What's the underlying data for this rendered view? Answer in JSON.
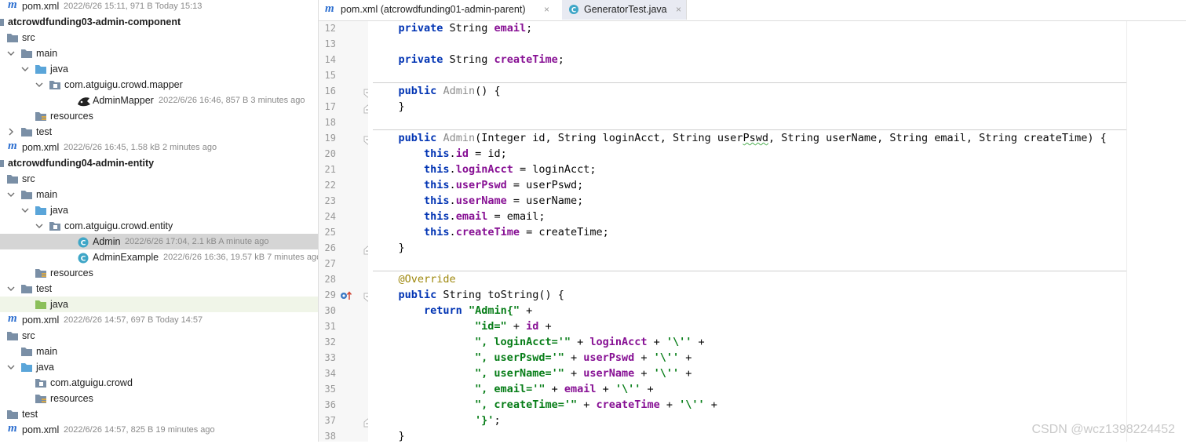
{
  "project_tree": [
    {
      "type": "pom",
      "name": "pom.xml",
      "meta": "2022/6/26 15:11, 971 B Today 15:13",
      "indent": 0
    },
    {
      "type": "module",
      "name": "atcrowdfunding03-admin-component",
      "indent": 0
    },
    {
      "type": "folder",
      "name": "src",
      "indent": 0
    },
    {
      "type": "folder",
      "name": "main",
      "indent": 1,
      "chevron": "down"
    },
    {
      "type": "src-folder",
      "name": "java",
      "indent": 2,
      "chevron": "down"
    },
    {
      "type": "package",
      "name": "com.atguigu.crowd.mapper",
      "indent": 3,
      "chevron": "down"
    },
    {
      "type": "mybatis",
      "name": "AdminMapper",
      "meta": "2022/6/26 16:46, 857 B 3 minutes ago",
      "indent": 5
    },
    {
      "type": "res-folder",
      "name": "resources",
      "indent": 2
    },
    {
      "type": "folder",
      "name": "test",
      "indent": 1,
      "chevron": "right"
    },
    {
      "type": "pom",
      "name": "pom.xml",
      "meta": "2022/6/26 16:45, 1.58 kB 2 minutes ago",
      "indent": 0
    },
    {
      "type": "module",
      "name": "atcrowdfunding04-admin-entity",
      "indent": 0
    },
    {
      "type": "folder",
      "name": "src",
      "indent": 0
    },
    {
      "type": "folder",
      "name": "main",
      "indent": 1,
      "chevron": "down"
    },
    {
      "type": "src-folder",
      "name": "java",
      "indent": 2,
      "chevron": "down"
    },
    {
      "type": "package",
      "name": "com.atguigu.crowd.entity",
      "indent": 3,
      "chevron": "down"
    },
    {
      "type": "class",
      "name": "Admin",
      "meta": "2022/6/26 17:04, 2.1 kB A minute ago",
      "indent": 5,
      "selected": true
    },
    {
      "type": "class",
      "name": "AdminExample",
      "meta": "2022/6/26 16:36, 19.57 kB 7 minutes ago",
      "indent": 5
    },
    {
      "type": "res-folder",
      "name": "resources",
      "indent": 2
    },
    {
      "type": "folder",
      "name": "test",
      "indent": 1,
      "chevron": "down"
    },
    {
      "type": "test-folder",
      "name": "java",
      "indent": 2,
      "highlight": true
    },
    {
      "type": "pom",
      "name": "pom.xml",
      "meta": "2022/6/26 14:57, 697 B Today 14:57",
      "indent": 0
    },
    {
      "type": "folder",
      "name": "src",
      "indent": 0
    },
    {
      "type": "folder",
      "name": "main",
      "indent": 1
    },
    {
      "type": "src-folder",
      "name": "java",
      "indent": 1,
      "chevron": "down"
    },
    {
      "type": "package",
      "name": "com.atguigu.crowd",
      "indent": 2
    },
    {
      "type": "res-folder",
      "name": "resources",
      "indent": 2
    },
    {
      "type": "folder",
      "name": "test",
      "indent": 0
    },
    {
      "type": "pom",
      "name": "pom.xml",
      "meta": "2022/6/26 14:57, 825 B 19 minutes ago",
      "indent": 0
    }
  ],
  "tabs": [
    {
      "label": "pom.xml (atcrowdfunding01-admin-parent)",
      "icon": "maven-m-icon",
      "active": false
    },
    {
      "label": "GeneratorTest.java",
      "icon": "java-class-icon",
      "active": true
    }
  ],
  "editor": {
    "lines": [
      {
        "n": "12",
        "tokens": [
          {
            "t": "    "
          },
          {
            "t": "private",
            "c": "kw"
          },
          {
            "t": " String "
          },
          {
            "t": "email",
            "c": "fld"
          },
          {
            "t": ";"
          }
        ]
      },
      {
        "n": "13",
        "tokens": []
      },
      {
        "n": "14",
        "tokens": [
          {
            "t": "    "
          },
          {
            "t": "private",
            "c": "kw"
          },
          {
            "t": " String "
          },
          {
            "t": "createTime",
            "c": "fld"
          },
          {
            "t": ";"
          }
        ]
      },
      {
        "n": "15",
        "tokens": []
      },
      {
        "n": "16",
        "fold": "open",
        "sep": true,
        "tokens": [
          {
            "t": "    "
          },
          {
            "t": "public",
            "c": "kw"
          },
          {
            "t": " "
          },
          {
            "t": "Admin",
            "c": "gry"
          },
          {
            "t": "() {"
          }
        ]
      },
      {
        "n": "17",
        "fold": "close",
        "tokens": [
          {
            "t": "    }"
          }
        ]
      },
      {
        "n": "18",
        "tokens": []
      },
      {
        "n": "19",
        "fold": "open",
        "sep": true,
        "tokens": [
          {
            "t": "    "
          },
          {
            "t": "public",
            "c": "kw"
          },
          {
            "t": " "
          },
          {
            "t": "Admin",
            "c": "gry"
          },
          {
            "t": "(Integer id, String loginAcct, String user"
          },
          {
            "t": "Pswd",
            "c": "typo"
          },
          {
            "t": ", String userName, String email, String createTime) {"
          }
        ]
      },
      {
        "n": "20",
        "tokens": [
          {
            "t": "        "
          },
          {
            "t": "this",
            "c": "kw"
          },
          {
            "t": "."
          },
          {
            "t": "id",
            "c": "fld"
          },
          {
            "t": " = id;"
          }
        ]
      },
      {
        "n": "21",
        "tokens": [
          {
            "t": "        "
          },
          {
            "t": "this",
            "c": "kw"
          },
          {
            "t": "."
          },
          {
            "t": "loginAcct",
            "c": "fld"
          },
          {
            "t": " = loginAcct;"
          }
        ]
      },
      {
        "n": "22",
        "tokens": [
          {
            "t": "        "
          },
          {
            "t": "this",
            "c": "kw"
          },
          {
            "t": "."
          },
          {
            "t": "userPswd",
            "c": "fld"
          },
          {
            "t": " = userPswd;"
          }
        ]
      },
      {
        "n": "23",
        "tokens": [
          {
            "t": "        "
          },
          {
            "t": "this",
            "c": "kw"
          },
          {
            "t": "."
          },
          {
            "t": "userName",
            "c": "fld"
          },
          {
            "t": " = userName;"
          }
        ]
      },
      {
        "n": "24",
        "tokens": [
          {
            "t": "        "
          },
          {
            "t": "this",
            "c": "kw"
          },
          {
            "t": "."
          },
          {
            "t": "email",
            "c": "fld"
          },
          {
            "t": " = email;"
          }
        ]
      },
      {
        "n": "25",
        "tokens": [
          {
            "t": "        "
          },
          {
            "t": "this",
            "c": "kw"
          },
          {
            "t": "."
          },
          {
            "t": "createTime",
            "c": "fld"
          },
          {
            "t": " = createTime;"
          }
        ]
      },
      {
        "n": "26",
        "fold": "close",
        "tokens": [
          {
            "t": "    }"
          }
        ]
      },
      {
        "n": "27",
        "tokens": []
      },
      {
        "n": "28",
        "sep": true,
        "tokens": [
          {
            "t": "    "
          },
          {
            "t": "@Override",
            "c": "ann"
          }
        ]
      },
      {
        "n": "29",
        "fold": "open",
        "override": true,
        "tokens": [
          {
            "t": "    "
          },
          {
            "t": "public",
            "c": "kw"
          },
          {
            "t": " String toString() {"
          }
        ]
      },
      {
        "n": "30",
        "tokens": [
          {
            "t": "        "
          },
          {
            "t": "return",
            "c": "kw"
          },
          {
            "t": " "
          },
          {
            "t": "\"Admin{\"",
            "c": "str"
          },
          {
            "t": " +"
          }
        ]
      },
      {
        "n": "31",
        "tokens": [
          {
            "t": "                "
          },
          {
            "t": "\"id=\"",
            "c": "str"
          },
          {
            "t": " + "
          },
          {
            "t": "id",
            "c": "fld"
          },
          {
            "t": " +"
          }
        ]
      },
      {
        "n": "32",
        "tokens": [
          {
            "t": "                "
          },
          {
            "t": "\", loginAcct='\"",
            "c": "str"
          },
          {
            "t": " + "
          },
          {
            "t": "loginAcct",
            "c": "fld"
          },
          {
            "t": " + "
          },
          {
            "t": "'\\''",
            "c": "str"
          },
          {
            "t": " +"
          }
        ]
      },
      {
        "n": "33",
        "tokens": [
          {
            "t": "                "
          },
          {
            "t": "\", userPswd='\"",
            "c": "str"
          },
          {
            "t": " + "
          },
          {
            "t": "userPswd",
            "c": "fld"
          },
          {
            "t": " + "
          },
          {
            "t": "'\\''",
            "c": "str"
          },
          {
            "t": " +"
          }
        ]
      },
      {
        "n": "34",
        "tokens": [
          {
            "t": "                "
          },
          {
            "t": "\", userName='\"",
            "c": "str"
          },
          {
            "t": " + "
          },
          {
            "t": "userName",
            "c": "fld"
          },
          {
            "t": " + "
          },
          {
            "t": "'\\''",
            "c": "str"
          },
          {
            "t": " +"
          }
        ]
      },
      {
        "n": "35",
        "tokens": [
          {
            "t": "                "
          },
          {
            "t": "\", email='\"",
            "c": "str"
          },
          {
            "t": " + "
          },
          {
            "t": "email",
            "c": "fld"
          },
          {
            "t": " + "
          },
          {
            "t": "'\\''",
            "c": "str"
          },
          {
            "t": " +"
          }
        ]
      },
      {
        "n": "36",
        "tokens": [
          {
            "t": "                "
          },
          {
            "t": "\", createTime='\"",
            "c": "str"
          },
          {
            "t": " + "
          },
          {
            "t": "createTime",
            "c": "fld"
          },
          {
            "t": " + "
          },
          {
            "t": "'\\''",
            "c": "str"
          },
          {
            "t": " +"
          }
        ]
      },
      {
        "n": "37",
        "fold": "close",
        "tokens": [
          {
            "t": "                "
          },
          {
            "t": "'}'",
            "c": "str"
          },
          {
            "t": ";"
          }
        ]
      },
      {
        "n": "38",
        "tokens": [
          {
            "t": "    }"
          }
        ]
      }
    ]
  },
  "watermark": "CSDN @wcz1398224452",
  "colors": {
    "keyword": "#0033b3",
    "field": "#871094",
    "string": "#067d17",
    "annotation": "#9e880d",
    "selection": "#d5d5d5",
    "maven": "#2d6fd0",
    "folder": "#7a8fa6",
    "java_folder": "#5aa5d9",
    "test_folder": "#8bbf5a"
  }
}
